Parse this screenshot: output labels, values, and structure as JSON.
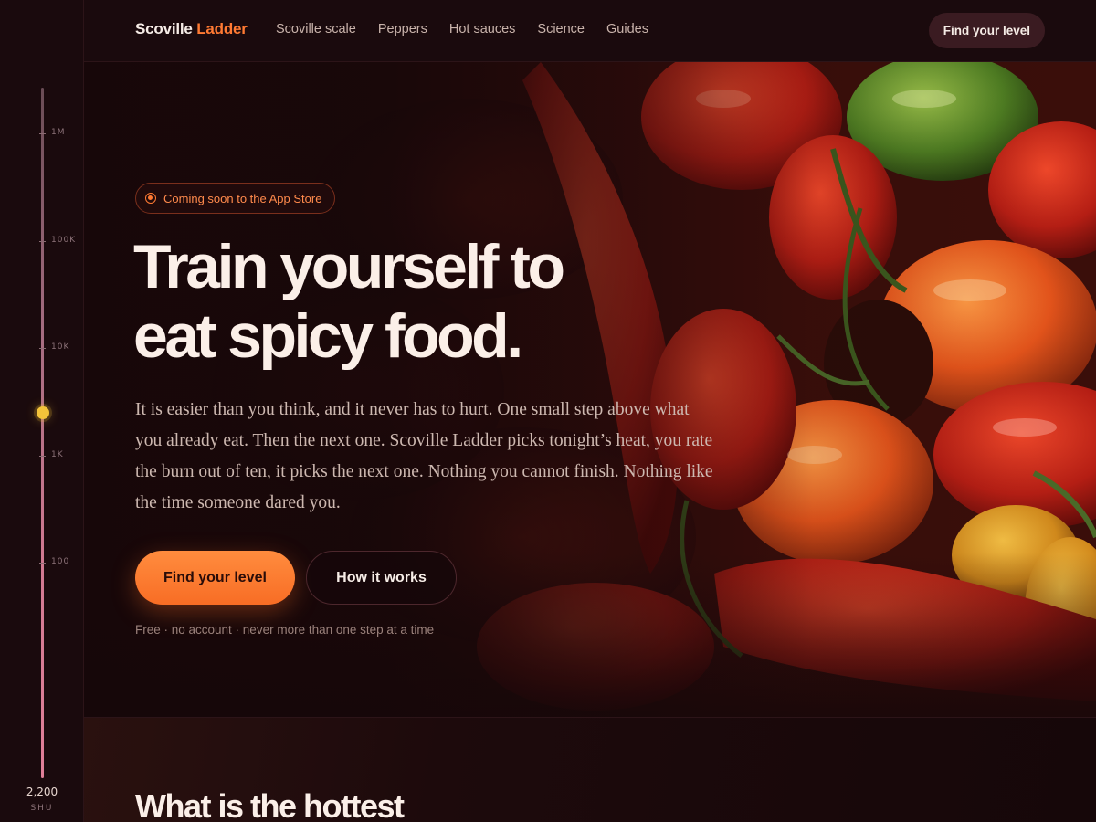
{
  "brand": {
    "name_part1": "Scoville",
    "name_part2": "Ladder",
    "accent_color": "#ff7a33"
  },
  "nav": {
    "links": [
      {
        "label": "Scoville scale"
      },
      {
        "label": "Peppers"
      },
      {
        "label": "Hot sauces"
      },
      {
        "label": "Science"
      },
      {
        "label": "Guides"
      }
    ],
    "cta_label": "Find your level"
  },
  "rail": {
    "ticks": [
      "1M",
      "100K",
      "10K",
      "1K",
      "100"
    ],
    "current_value": "2,200",
    "unit": "SHU",
    "thumb_color": "#f3c33a"
  },
  "hero": {
    "badge": "Coming soon to the App Store",
    "headline_line1": "Train yourself to",
    "headline_line2": "eat spicy food.",
    "lede": "It is easier than you think, and it never has to hurt. One small step above what you already eat. Then the next one. Scoville Ladder picks tonight’s heat, you rate the burn out of ten, it picks the next one. Nothing you cannot finish. Nothing like the time someone dared you.",
    "primary_button": "Find your level",
    "secondary_button": "How it works",
    "fineprint": "Free · no account · never more than one step at a time",
    "image_subject": "pile of red, orange and green chili peppers"
  },
  "section2": {
    "title": "What is the hottest"
  }
}
